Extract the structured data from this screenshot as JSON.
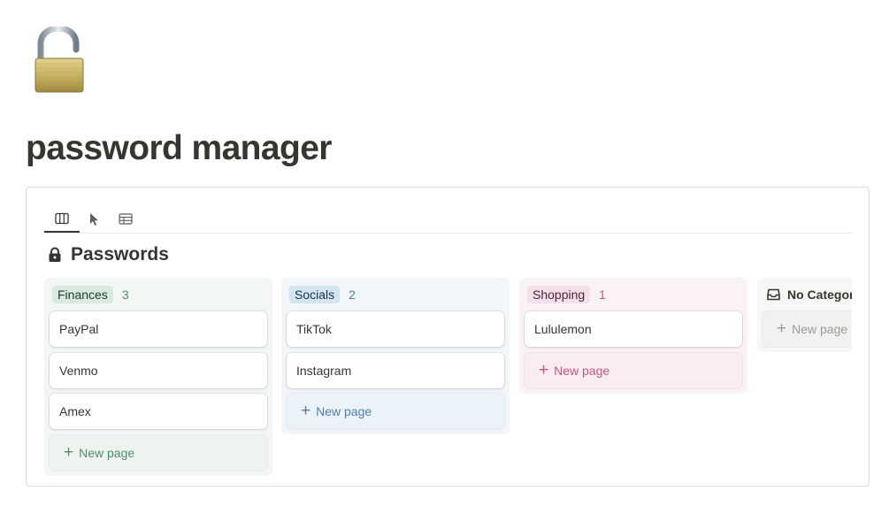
{
  "page": {
    "icon": "open-padlock-icon",
    "title": "password manager"
  },
  "database": {
    "views": [
      {
        "icon": "board-view-icon",
        "active": true
      },
      {
        "icon": "cursor-icon",
        "active": false
      },
      {
        "icon": "table-view-icon",
        "active": false
      }
    ],
    "title_icon": "lock-icon",
    "title": "Passwords",
    "columns": [
      {
        "label": "Finances",
        "count": "3",
        "color": "#4f8e6b",
        "cards": [
          "PayPal",
          "Venmo",
          "Amex"
        ],
        "new_page": "New page"
      },
      {
        "label": "Socials",
        "count": "2",
        "color": "#4f7fa8",
        "cards": [
          "TikTok",
          "Instagram"
        ],
        "new_page": "New page"
      },
      {
        "label": "Shopping",
        "count": "1",
        "color": "#c0587f",
        "cards": [
          "Lululemon"
        ],
        "new_page": "New page"
      },
      {
        "label": "No Category",
        "icon": "inbox-icon",
        "cards": [],
        "new_page": "New page"
      }
    ]
  }
}
